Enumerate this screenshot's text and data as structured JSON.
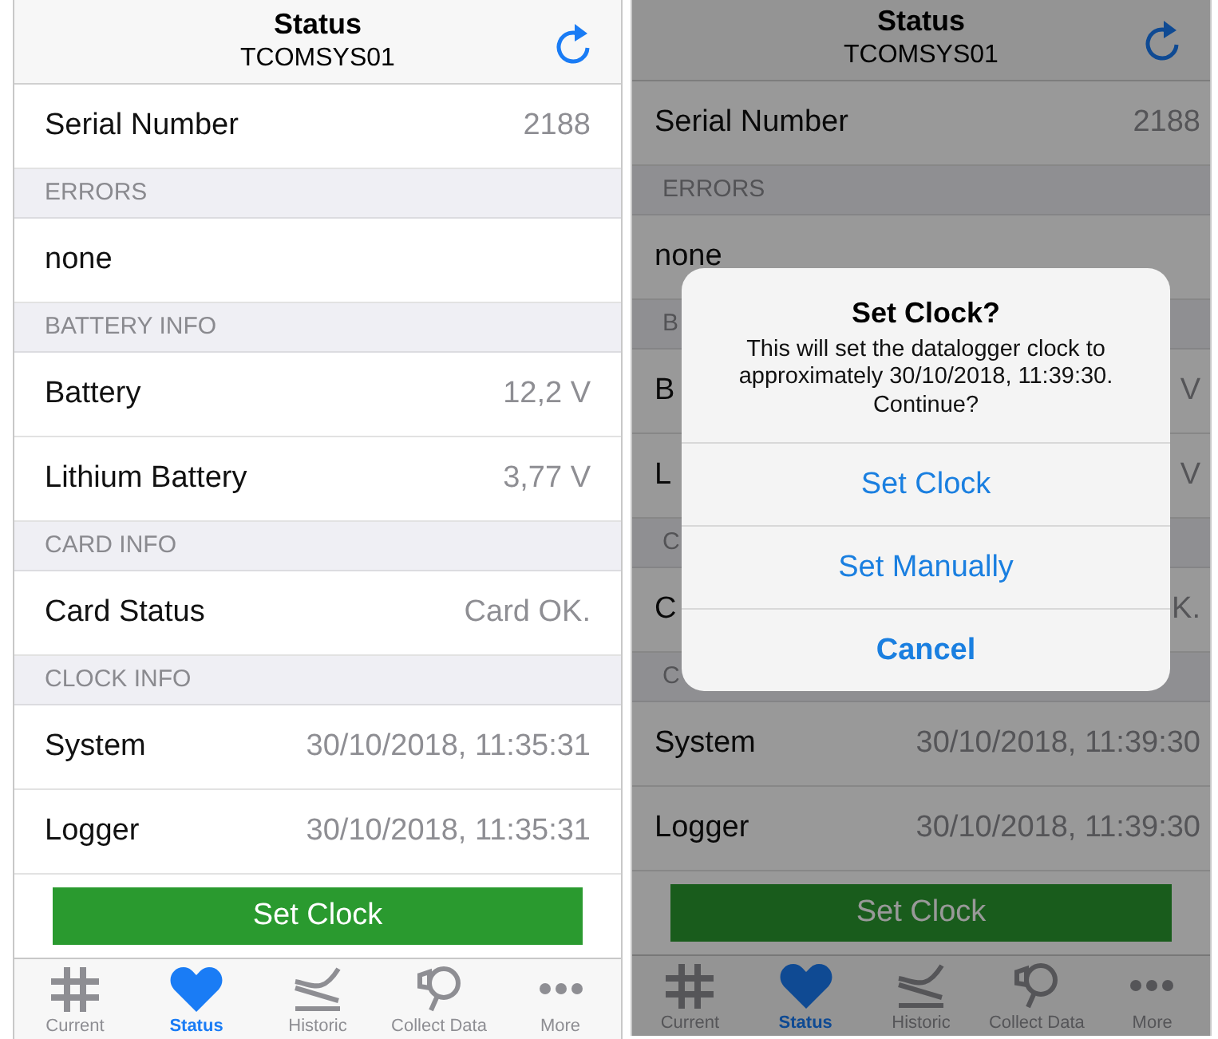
{
  "phones": [
    {
      "header": {
        "title": "Status",
        "subtitle": "TCOMSYS01"
      },
      "items": [
        {
          "kind": "row",
          "label": "Serial Number",
          "value": "2188"
        },
        {
          "kind": "section",
          "label": "ERRORS"
        },
        {
          "kind": "row",
          "label": "none",
          "value": ""
        },
        {
          "kind": "section",
          "label": "BATTERY INFO"
        },
        {
          "kind": "row",
          "label": "Battery",
          "value": "12,2 V"
        },
        {
          "kind": "row",
          "label": "Lithium Battery",
          "value": "3,77 V"
        },
        {
          "kind": "section",
          "label": "CARD INFO"
        },
        {
          "kind": "row",
          "label": "Card Status",
          "value": "Card OK."
        },
        {
          "kind": "section",
          "label": "CLOCK INFO"
        },
        {
          "kind": "row",
          "label": "System",
          "value": "30/10/2018, 11:35:31"
        },
        {
          "kind": "row",
          "label": "Logger",
          "value": "30/10/2018, 11:35:31"
        }
      ],
      "button": "Set Clock",
      "tabs": [
        {
          "kind": "hash",
          "label": "Current",
          "selected": false
        },
        {
          "kind": "heart",
          "label": "Status",
          "selected": true
        },
        {
          "kind": "historic",
          "label": "Historic",
          "selected": false
        },
        {
          "kind": "collect",
          "label": "Collect Data",
          "selected": false
        },
        {
          "kind": "more",
          "label": "More",
          "selected": false
        }
      ]
    },
    {
      "header": {
        "title": "Status",
        "subtitle": "TCOMSYS01"
      },
      "items": [
        {
          "kind": "row",
          "label": "Serial Number",
          "value": "2188"
        },
        {
          "kind": "section",
          "label": "ERRORS"
        },
        {
          "kind": "row",
          "label": "none",
          "value": ""
        },
        {
          "kind": "section",
          "label": "B"
        },
        {
          "kind": "row",
          "label": "B",
          "value": "V"
        },
        {
          "kind": "row",
          "label": "L",
          "value": "V"
        },
        {
          "kind": "section",
          "label": "C"
        },
        {
          "kind": "row",
          "label": "C",
          "value": "K."
        },
        {
          "kind": "section",
          "label": "C"
        },
        {
          "kind": "row",
          "label": "System",
          "value": "30/10/2018, 11:39:30"
        },
        {
          "kind": "row",
          "label": "Logger",
          "value": "30/10/2018, 11:39:30"
        }
      ],
      "button": "Set Clock",
      "tabs": [
        {
          "kind": "hash",
          "label": "Current",
          "selected": false
        },
        {
          "kind": "heart",
          "label": "Status",
          "selected": true
        },
        {
          "kind": "historic",
          "label": "Historic",
          "selected": false
        },
        {
          "kind": "collect",
          "label": "Collect Data",
          "selected": false
        },
        {
          "kind": "more",
          "label": "More",
          "selected": false
        }
      ],
      "dialog": {
        "title": "Set Clock?",
        "message": "This will set the datalogger clock to approximately 30/10/2018, 11:39:30. Continue?",
        "actions": [
          {
            "label": "Set Clock",
            "kind": "default"
          },
          {
            "label": "Set Manually",
            "kind": "default"
          },
          {
            "label": "Cancel",
            "kind": "cancel"
          }
        ]
      }
    }
  ]
}
